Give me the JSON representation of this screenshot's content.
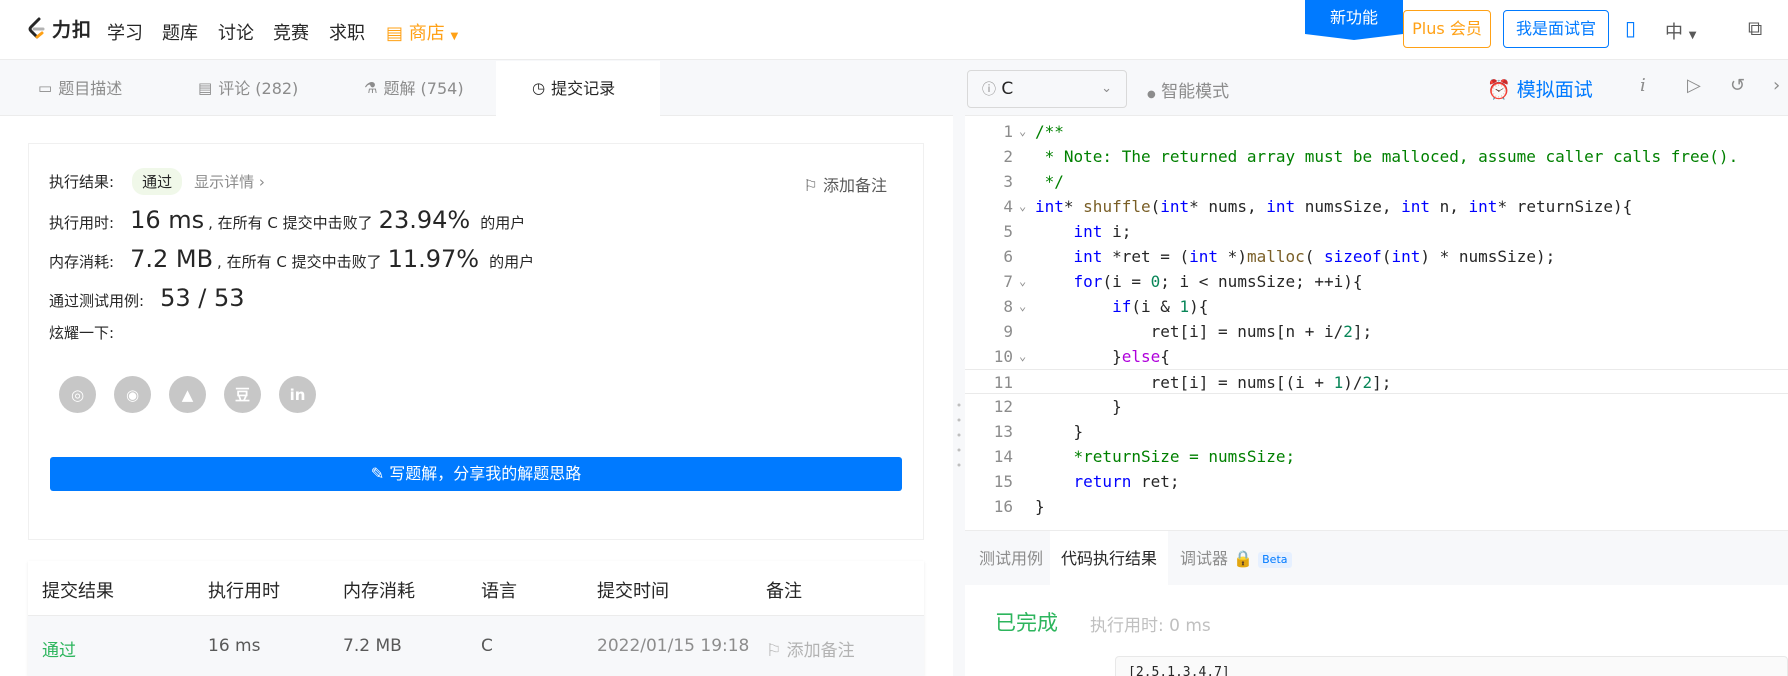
{
  "nav": {
    "logo_text": "力扣",
    "items": [
      "学习",
      "题库",
      "讨论",
      "竞赛",
      "求职"
    ],
    "store": "商店",
    "new_feature": "新功能",
    "plus": "Plus 会员",
    "interviewer": "我是面试官",
    "lang_switch": "中"
  },
  "left_tabs": [
    {
      "label": "题目描述",
      "icon": "description-icon"
    },
    {
      "label": "评论 (282)",
      "icon": "comment-icon"
    },
    {
      "label": "题解 (754)",
      "icon": "flask-icon"
    },
    {
      "label": "提交记录",
      "icon": "clock-icon"
    }
  ],
  "result": {
    "label": "执行结果:",
    "status": "通过",
    "detail_link": "显示详情",
    "add_note": "添加备注",
    "time_label": "执行用时:",
    "time_value": "16 ms",
    "time_beat": ", 在所有 C 提交中击败了",
    "time_pct": "23.94%",
    "users": "的用户",
    "mem_label": "内存消耗:",
    "mem_value": "7.2 MB",
    "mem_beat": ", 在所有 C 提交中击败了",
    "mem_pct": "11.97%",
    "tests_label": "通过测试用例:",
    "tests_value": "53 / 53",
    "share_label": "炫耀一下:",
    "share_icons": [
      "wechat-icon",
      "weibo-icon",
      "qq-icon",
      "douban-icon",
      "linkedin-icon"
    ],
    "write_solution": "写题解，分享我的解题思路"
  },
  "table": {
    "headers": [
      "提交结果",
      "执行用时",
      "内存消耗",
      "语言",
      "提交时间",
      "备注"
    ],
    "row": {
      "result": "通过",
      "time": "16 ms",
      "memory": "7.2 MB",
      "lang": "C",
      "submitted": "2022/01/15 19:18",
      "note": "添加备注"
    }
  },
  "editor_toolbar": {
    "language": "C",
    "smart_mode": "智能模式",
    "mock_interview": "模拟面试"
  },
  "code_lines": [
    {
      "n": "1",
      "fold": true,
      "text": "/**"
    },
    {
      "n": "2",
      "fold": false,
      "text": " * Note: The returned array must be malloced, assume caller calls free()."
    },
    {
      "n": "3",
      "fold": false,
      "text": " */"
    },
    {
      "n": "4",
      "fold": true,
      "text": "int* shuffle(int* nums, int numsSize, int n, int* returnSize){"
    },
    {
      "n": "5",
      "fold": false,
      "text": "    int i;"
    },
    {
      "n": "6",
      "fold": false,
      "text": "    int *ret = (int *)malloc( sizeof(int) * numsSize);"
    },
    {
      "n": "7",
      "fold": true,
      "text": "    for(i = 0; i < numsSize; ++i){"
    },
    {
      "n": "8",
      "fold": true,
      "text": "        if(i & 1){"
    },
    {
      "n": "9",
      "fold": false,
      "text": "            ret[i] = nums[n + i/2];"
    },
    {
      "n": "10",
      "fold": true,
      "text": "        }else{"
    },
    {
      "n": "11",
      "fold": false,
      "text": "            ret[i] = nums[(i + 1)/2];"
    },
    {
      "n": "12",
      "fold": false,
      "text": "        }"
    },
    {
      "n": "13",
      "fold": false,
      "text": "    }"
    },
    {
      "n": "14",
      "fold": false,
      "text": "    *returnSize = numsSize;"
    },
    {
      "n": "15",
      "fold": false,
      "text": "    return ret;"
    },
    {
      "n": "16",
      "fold": false,
      "text": "}"
    }
  ],
  "bottom_tabs": {
    "testcase": "测试用例",
    "exec_result": "代码执行结果",
    "debugger": "调试器",
    "beta": "Beta"
  },
  "exec": {
    "status": "已完成",
    "time": "执行用时: 0 ms",
    "output": "[2,5,1,3,4,7]"
  },
  "colors": {
    "accent": "#007aff",
    "orange": "#ffa116",
    "green": "#2db55d"
  }
}
